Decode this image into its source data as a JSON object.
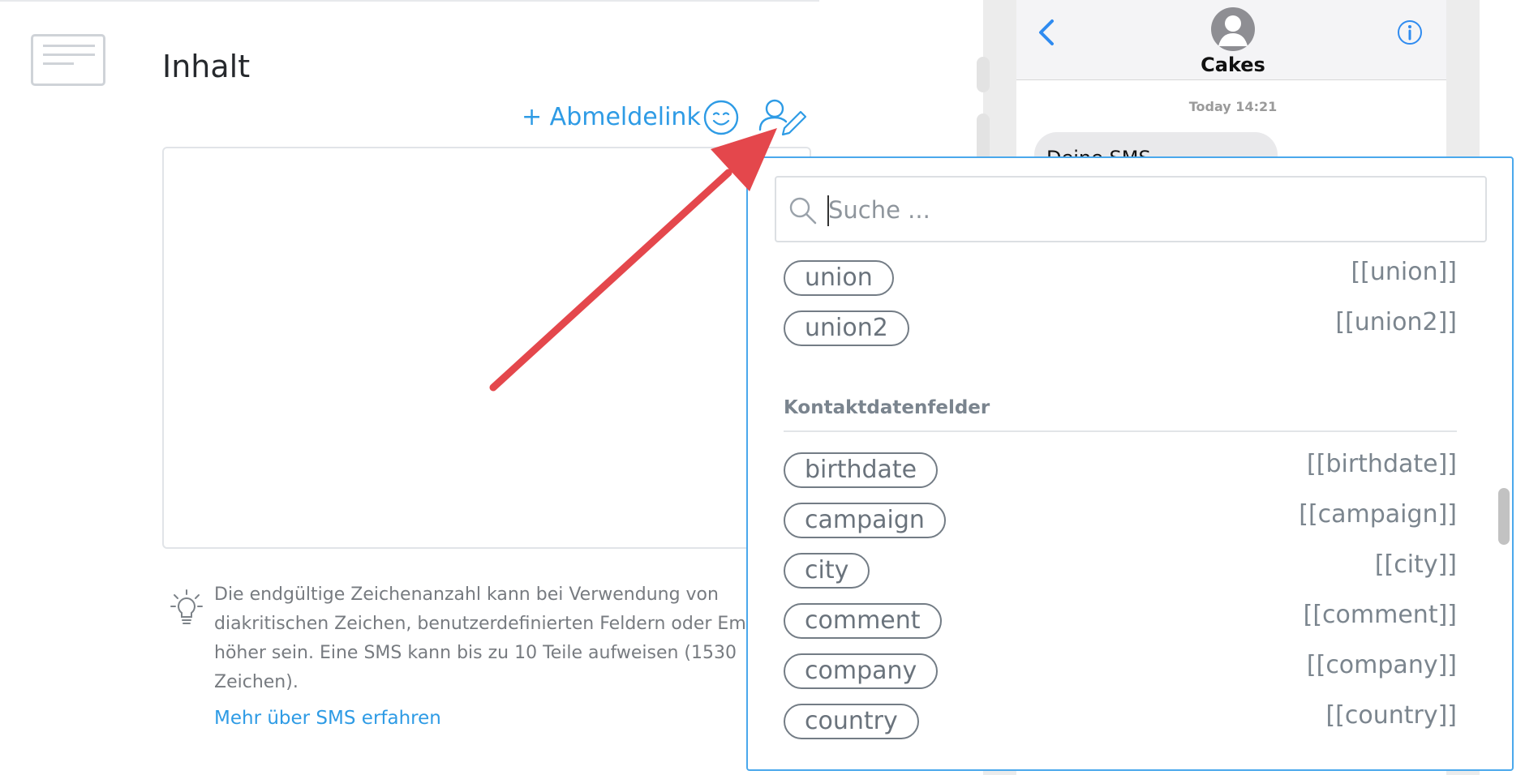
{
  "page": {
    "title": "Inhalt"
  },
  "toolbar": {
    "unsubscribe_link": "+ Abmeldelink"
  },
  "hint": {
    "lines": [
      "Die endgültige Zeichenanzahl kann bei Verwendung von",
      "diakritischen Zeichen, benutzerdefinierten Feldern oder Em",
      "höher sein. Eine SMS kann bis zu 10 Teile aufweisen (1530",
      "Zeichen)."
    ],
    "link": "Mehr über SMS erfahren"
  },
  "phone": {
    "contact": "Cakes",
    "timestamp": "Today 14:21",
    "bubble": "Deine SMS"
  },
  "dropdown": {
    "search_placeholder": "Suche ...",
    "items_top": [
      {
        "label": "union",
        "tag": "[[union]]"
      },
      {
        "label": "union2",
        "tag": "[[union2]]"
      }
    ],
    "section_title": "Kontaktdatenfelder",
    "items": [
      {
        "label": "birthdate",
        "tag": "[[birthdate]]"
      },
      {
        "label": "campaign",
        "tag": "[[campaign]]"
      },
      {
        "label": "city",
        "tag": "[[city]]"
      },
      {
        "label": "comment",
        "tag": "[[comment]]"
      },
      {
        "label": "company",
        "tag": "[[company]]"
      },
      {
        "label": "country",
        "tag": "[[country]]"
      }
    ]
  },
  "colors": {
    "accent": "#2e9be5",
    "dropdown_border": "#4aa8ec",
    "pill_border": "#737c85",
    "annotation_arrow": "#e4474c"
  },
  "icons": {
    "document": "document-icon",
    "emoji": "smiley-icon",
    "personalize": "user-edit-icon",
    "hint": "lightbulb-icon",
    "search": "search-icon",
    "back": "chevron-left-icon",
    "info": "info-icon",
    "avatar": "avatar-icon"
  }
}
